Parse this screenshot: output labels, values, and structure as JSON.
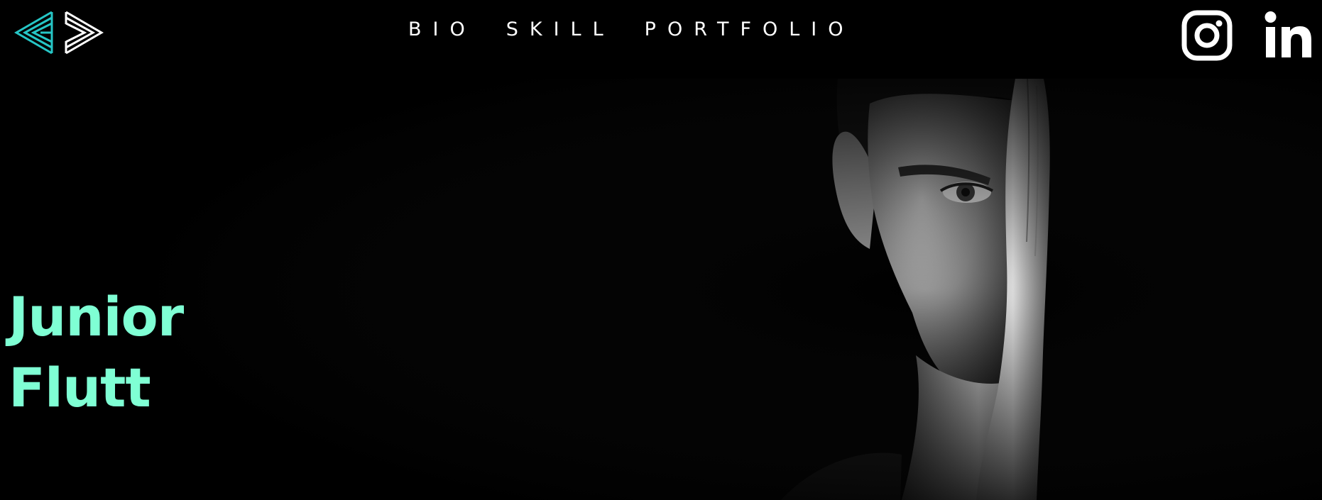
{
  "header": {
    "logo_name": "brand-logo",
    "nav": [
      {
        "label": "BIO"
      },
      {
        "label": "SKILL"
      },
      {
        "label": "PORTFOLIO"
      }
    ],
    "social": [
      {
        "icon": "instagram-icon"
      },
      {
        "icon": "linkedin-icon"
      }
    ]
  },
  "hero": {
    "headline_line1": "Junior",
    "headline_line2": "Flutt",
    "accent_color": "#7fffd4"
  },
  "colors": {
    "background": "#000000",
    "text": "#ffffff",
    "logo_accent": "#26c6c6"
  }
}
